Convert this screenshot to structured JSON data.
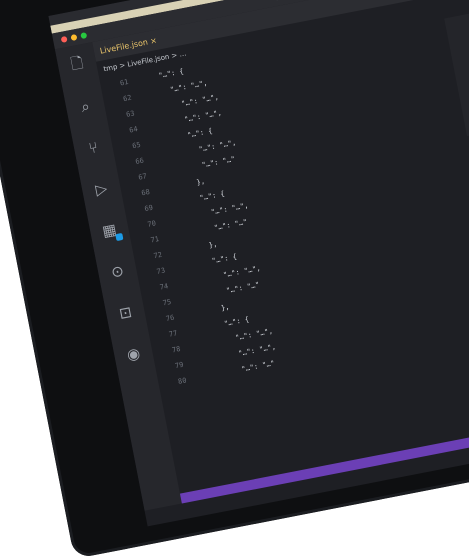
{
  "window": {
    "title": "…"
  },
  "menubar": [
    "",
    "",
    "",
    ""
  ],
  "bookmarks": [
    "",
    "",
    "",
    "",
    ""
  ],
  "tab": {
    "label": "LiveFile.json  ×"
  },
  "breadcrumb": "tmp > LiveFile.json > …",
  "activity_icons": [
    "files-icon",
    "search-icon",
    "source-control-icon",
    "run-icon",
    "extensions-icon",
    "remote-icon",
    "terminal-icon",
    "account-icon"
  ],
  "code": {
    "lines": [
      {
        "n": "61",
        "text": "    \"…\": {"
      },
      {
        "n": "62",
        "text": "      \"…\": \"…\","
      },
      {
        "n": "63",
        "text": "        \"…\": \"…\","
      },
      {
        "n": "64",
        "text": "        \"…\": \"…\","
      },
      {
        "n": "65",
        "text": "        \"…\": {"
      },
      {
        "n": "66",
        "text": "          \"…\": \"…\","
      },
      {
        "n": "67",
        "text": "          \"…\": \"…\""
      },
      {
        "n": "68",
        "text": "        },"
      },
      {
        "n": "69",
        "text": "        \"…\": {"
      },
      {
        "n": "70",
        "text": "          \"…\": \"…\","
      },
      {
        "n": "71",
        "text": "          \"…\": \"…\""
      },
      {
        "n": "72",
        "text": "        },"
      },
      {
        "n": "73",
        "text": "        \"…\": {"
      },
      {
        "n": "74",
        "text": "          \"…\": \"…\","
      },
      {
        "n": "75",
        "text": "          \"…\": \"…\""
      },
      {
        "n": "76",
        "text": "        },"
      },
      {
        "n": "77",
        "text": "        \"…\": {"
      },
      {
        "n": "78",
        "text": "          \"…\": \"…\","
      },
      {
        "n": "79",
        "text": "          \"…\": \"…\","
      },
      {
        "n": "80",
        "text": "          \"…\": \"…\""
      }
    ]
  },
  "colors": {
    "accent": "#1c9be6",
    "tab_text": "#e9c46a",
    "status_bar": "#6b3fb5"
  }
}
